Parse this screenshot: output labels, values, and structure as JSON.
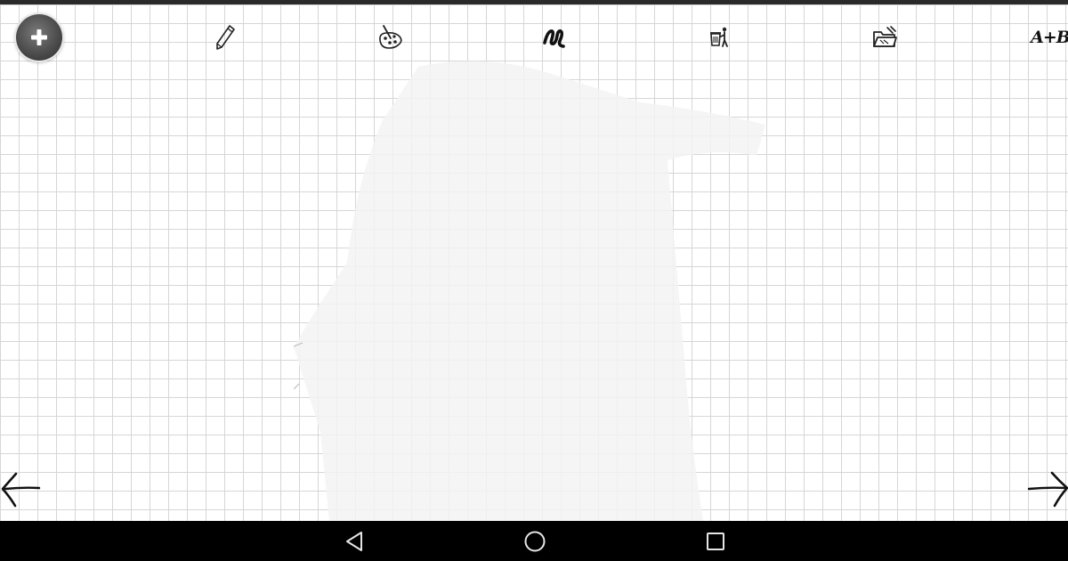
{
  "app": {
    "grid_color": "#d6d6d6",
    "background_color": "#ffffff"
  },
  "toolbar": {
    "add_icon": "plus-icon",
    "tools": [
      {
        "icon": "pencil-icon"
      },
      {
        "icon": "palette-icon"
      },
      {
        "icon": "brush-stroke-icon"
      },
      {
        "icon": "trash-can-icon"
      },
      {
        "icon": "open-folder-icon"
      },
      {
        "icon": "text-ab-icon",
        "label": "A+B"
      }
    ]
  },
  "navigation": {
    "prev_icon": "arrow-left-icon",
    "next_icon": "arrow-right-icon"
  },
  "system_nav": {
    "back_icon": "back-triangle-icon",
    "home_icon": "home-circle-icon",
    "recents_icon": "recents-square-icon"
  }
}
